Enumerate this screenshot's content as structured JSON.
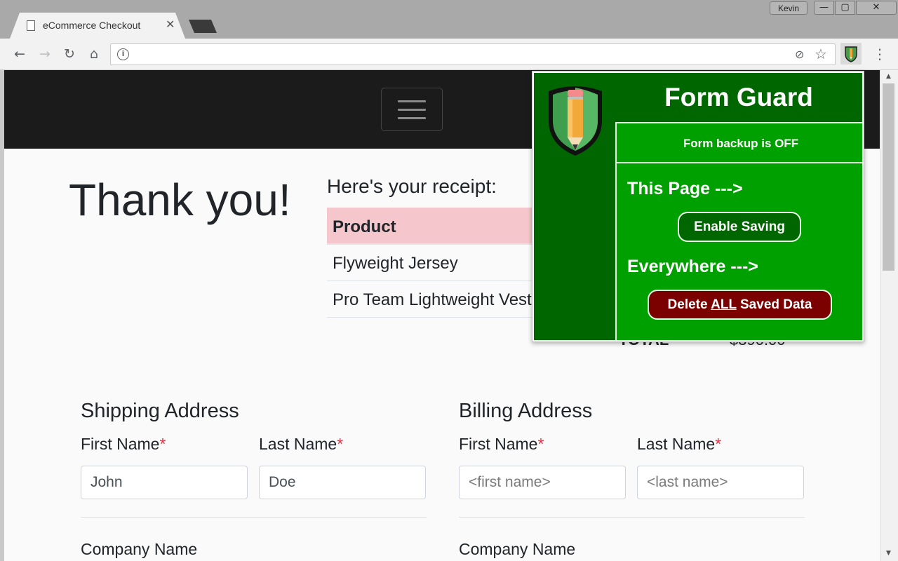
{
  "browser": {
    "tab_title": "eCommerce Checkout",
    "tab_close": "✕",
    "user_name": "Kevin",
    "window_buttons": {
      "minimize": "—",
      "maximize": "▢",
      "close": "✕"
    },
    "nav": {
      "back": "←",
      "forward": "→",
      "reload": "↻",
      "home": "⌂",
      "info": "i",
      "star": "☆",
      "menu": "⋮",
      "blocked": "⊘"
    }
  },
  "page": {
    "heading": "Thank you!",
    "receipt_title": "Here's your receipt:",
    "table_header": "Product",
    "rows": [
      {
        "product": "Flyweight Jersey"
      },
      {
        "product": "Pro Team Lightweight Vest"
      }
    ],
    "total_label": "TOTAL",
    "total_value": "$390.00",
    "shipping": {
      "title": "Shipping Address",
      "first_name_label": "First Name",
      "last_name_label": "Last Name",
      "required_mark": "*",
      "first_name_value": "John",
      "last_name_value": "Doe",
      "company_label": "Company Name"
    },
    "billing": {
      "title": "Billing Address",
      "first_name_label": "First Name",
      "last_name_label": "Last Name",
      "required_mark": "*",
      "first_name_placeholder": "<first name>",
      "last_name_placeholder": "<last name>",
      "company_label": "Company Name"
    }
  },
  "extension": {
    "title": "Form Guard",
    "status": "Form backup is OFF",
    "this_page_heading": "This Page --->",
    "enable_button": "Enable Saving",
    "everywhere_heading": "Everywhere --->",
    "delete_prefix": "Delete ",
    "delete_emphasis": "ALL",
    "delete_suffix": " Saved Data"
  },
  "colors": {
    "popup_dark_green": "#006600",
    "popup_green": "#00a000",
    "delete_red": "#7b0000",
    "table_header_pink": "#f5c6cb",
    "required_red": "#dc3545",
    "navbar_black": "#1b1b1b"
  }
}
